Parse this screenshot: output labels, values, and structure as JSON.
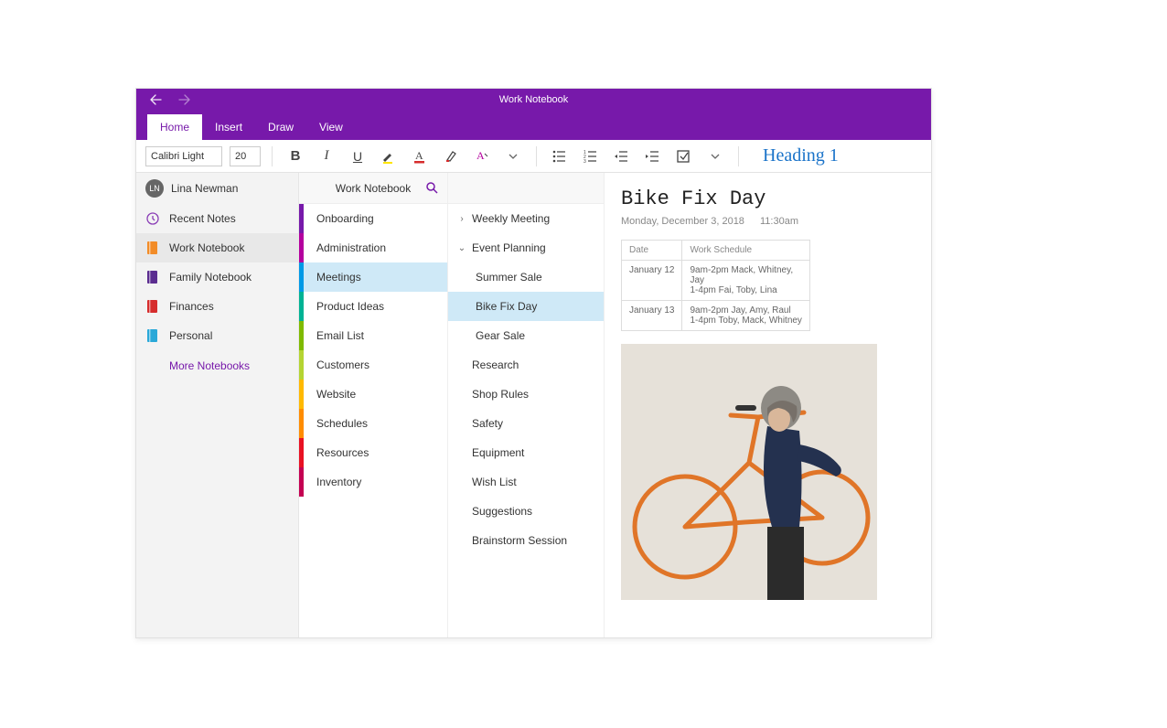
{
  "titlebar": {
    "title": "Work Notebook"
  },
  "tabs": {
    "home": "Home",
    "insert": "Insert",
    "draw": "Draw",
    "view": "View"
  },
  "ribbon": {
    "font_name": "Calibri Light",
    "font_size": "20",
    "heading_style": "Heading 1"
  },
  "user": {
    "initials": "LN",
    "name": "Lina Newman"
  },
  "notebooks": {
    "recent": "Recent Notes",
    "items": [
      {
        "label": "Work Notebook",
        "color": "#f28c28"
      },
      {
        "label": "Family Notebook",
        "color": "#5b2d90"
      },
      {
        "label": "Finances",
        "color": "#d62d2d"
      },
      {
        "label": "Personal",
        "color": "#2aa8d8"
      }
    ],
    "more": "More Notebooks"
  },
  "sections_header": "Work Notebook",
  "sections": [
    {
      "label": "Onboarding",
      "color": "#7719AA"
    },
    {
      "label": "Administration",
      "color": "#b4009e"
    },
    {
      "label": "Meetings",
      "color": "#0099e6"
    },
    {
      "label": "Product Ideas",
      "color": "#00b294"
    },
    {
      "label": "Email List",
      "color": "#7fba00"
    },
    {
      "label": "Customers",
      "color": "#b4d432"
    },
    {
      "label": "Website",
      "color": "#ffb900"
    },
    {
      "label": "Schedules",
      "color": "#ff8c00"
    },
    {
      "label": "Resources",
      "color": "#e81123"
    },
    {
      "label": "Inventory",
      "color": "#c40052"
    }
  ],
  "pages": [
    {
      "label": "Weekly Meeting",
      "chev": "right"
    },
    {
      "label": "Event Planning",
      "chev": "down"
    },
    {
      "label": "Summer Sale",
      "child": true
    },
    {
      "label": "Bike Fix Day",
      "child": true,
      "selected": true
    },
    {
      "label": "Gear Sale",
      "child": true
    },
    {
      "label": "Research"
    },
    {
      "label": "Shop Rules"
    },
    {
      "label": "Safety"
    },
    {
      "label": "Equipment"
    },
    {
      "label": "Wish List"
    },
    {
      "label": "Suggestions"
    },
    {
      "label": "Brainstorm Session"
    }
  ],
  "content": {
    "title": "Bike Fix Day",
    "date": "Monday, December 3, 2018",
    "time": "11:30am",
    "table": {
      "headers": [
        "Date",
        "Work Schedule"
      ],
      "rows": [
        [
          "January 12",
          "9am-2pm Mack, Whitney, Jay\n1-4pm Fai, Toby, Lina"
        ],
        [
          "January 13",
          "9am-2pm Jay, Amy, Raul\n1-4pm Toby, Mack, Whitney"
        ]
      ]
    }
  }
}
